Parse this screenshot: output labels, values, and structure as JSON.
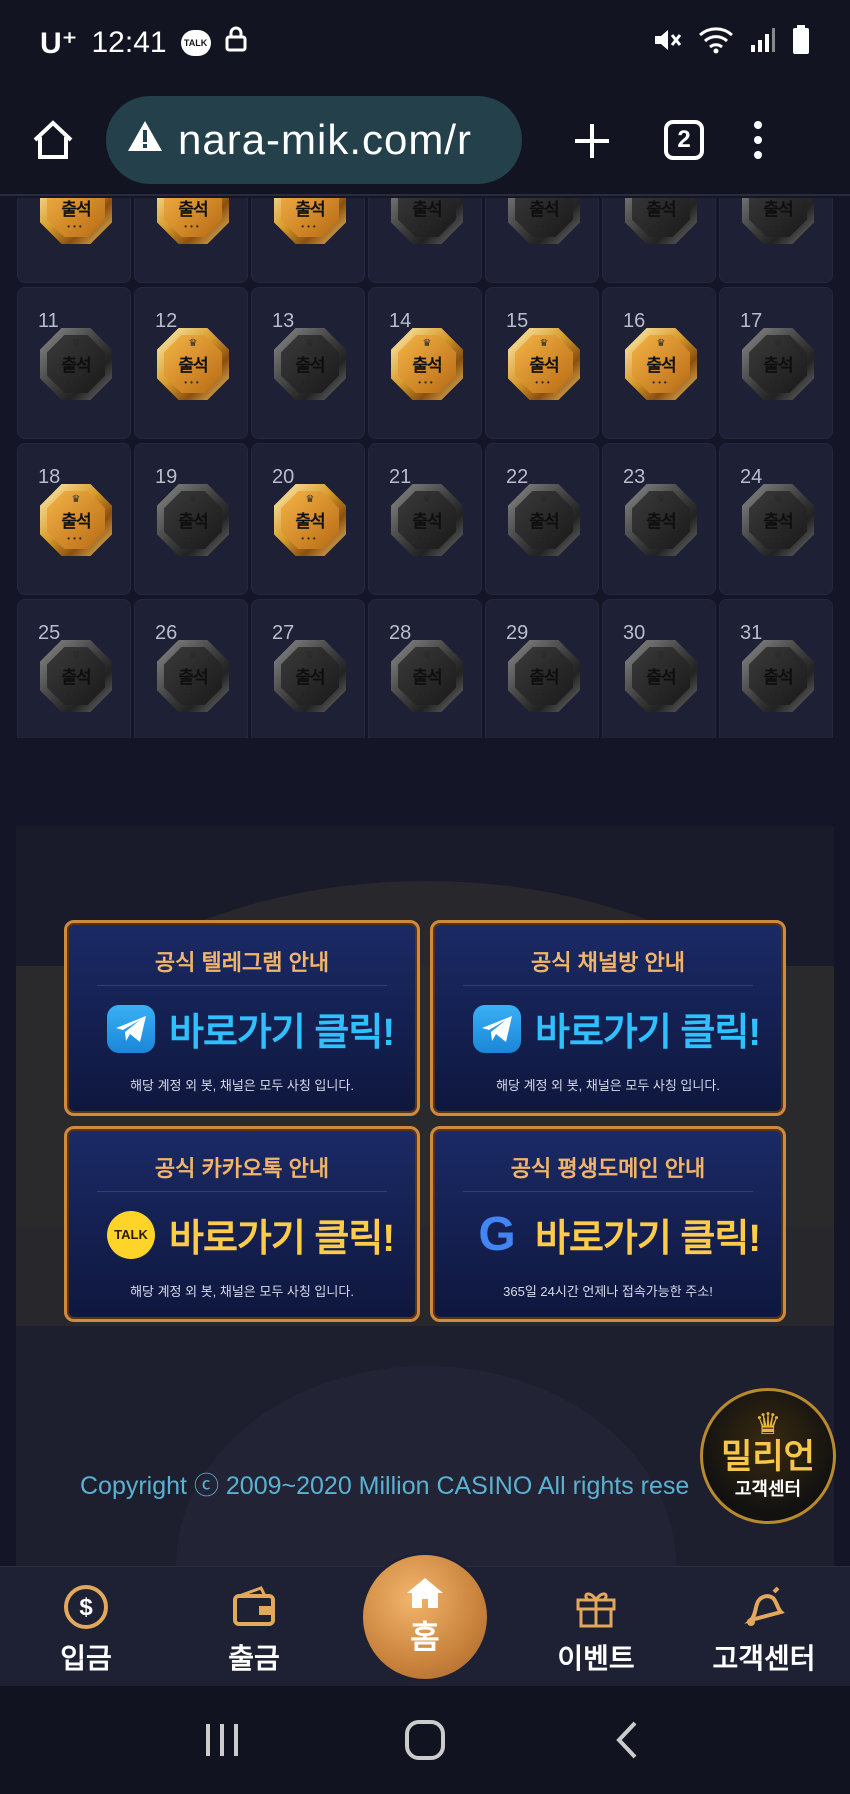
{
  "status_bar": {
    "carrier": "U⁺",
    "time": "12:41",
    "talk_label": "TALK"
  },
  "browser": {
    "url": "nara-mik.com/r",
    "tab_count": "2"
  },
  "calendar": {
    "days": [
      {
        "num": "",
        "state": "gold"
      },
      {
        "num": "",
        "state": "gold"
      },
      {
        "num": "",
        "state": "gold"
      },
      {
        "num": "",
        "state": "gray"
      },
      {
        "num": "",
        "state": "gray"
      },
      {
        "num": "",
        "state": "gray"
      },
      {
        "num": "",
        "state": "gray"
      },
      {
        "num": "11",
        "state": "gray"
      },
      {
        "num": "12",
        "state": "gold"
      },
      {
        "num": "13",
        "state": "gray"
      },
      {
        "num": "14",
        "state": "gold"
      },
      {
        "num": "15",
        "state": "gold"
      },
      {
        "num": "16",
        "state": "gold"
      },
      {
        "num": "17",
        "state": "gray"
      },
      {
        "num": "18",
        "state": "gold"
      },
      {
        "num": "19",
        "state": "gray"
      },
      {
        "num": "20",
        "state": "gold"
      },
      {
        "num": "21",
        "state": "gray"
      },
      {
        "num": "22",
        "state": "gray"
      },
      {
        "num": "23",
        "state": "gray"
      },
      {
        "num": "24",
        "state": "gray"
      },
      {
        "num": "25",
        "state": "gray"
      },
      {
        "num": "26",
        "state": "gray"
      },
      {
        "num": "27",
        "state": "gray"
      },
      {
        "num": "28",
        "state": "gray"
      },
      {
        "num": "29",
        "state": "gray"
      },
      {
        "num": "30",
        "state": "gray"
      },
      {
        "num": "31",
        "state": "gray"
      }
    ],
    "badge_label": "출석"
  },
  "cards": {
    "telegram": {
      "title": "공식 텔레그램 안내",
      "cta": "바로가기 클릭!",
      "note": "해당 계정 외 봇, 채널은 모두 사칭 입니다."
    },
    "channel": {
      "title": "공식 채널방 안내",
      "cta": "바로가기 클릭!",
      "note": "해당 계정 외 봇, 채널은 모두 사칭 입니다."
    },
    "kakao": {
      "title": "공식 카카오톡 안내",
      "cta": "바로가기 클릭!",
      "note": "해당 계정 외 봇, 채널은 모두 사칭 입니다.",
      "icon_text": "TALK"
    },
    "domain": {
      "title": "공식 평생도메인 안내",
      "cta": "바로가기 클릭!",
      "note": "365일 24시간 언제나 접속가능한 주소!",
      "icon_text": "G"
    }
  },
  "footer": {
    "copyright": "Copyright ⓒ 2009~2020 Million CASINO All rights rese"
  },
  "floating_cs": {
    "brand": "밀리언",
    "sub": "고객센터"
  },
  "bottom_nav": {
    "deposit": "입금",
    "withdraw": "출금",
    "home": "홈",
    "event": "이벤트",
    "support": "고객센터"
  },
  "colors": {
    "accent_gold": "#d08a3e",
    "cta_blue": "#2fc1ff",
    "cta_gold": "#ffcc4a",
    "copyright": "#5ab2d3"
  }
}
